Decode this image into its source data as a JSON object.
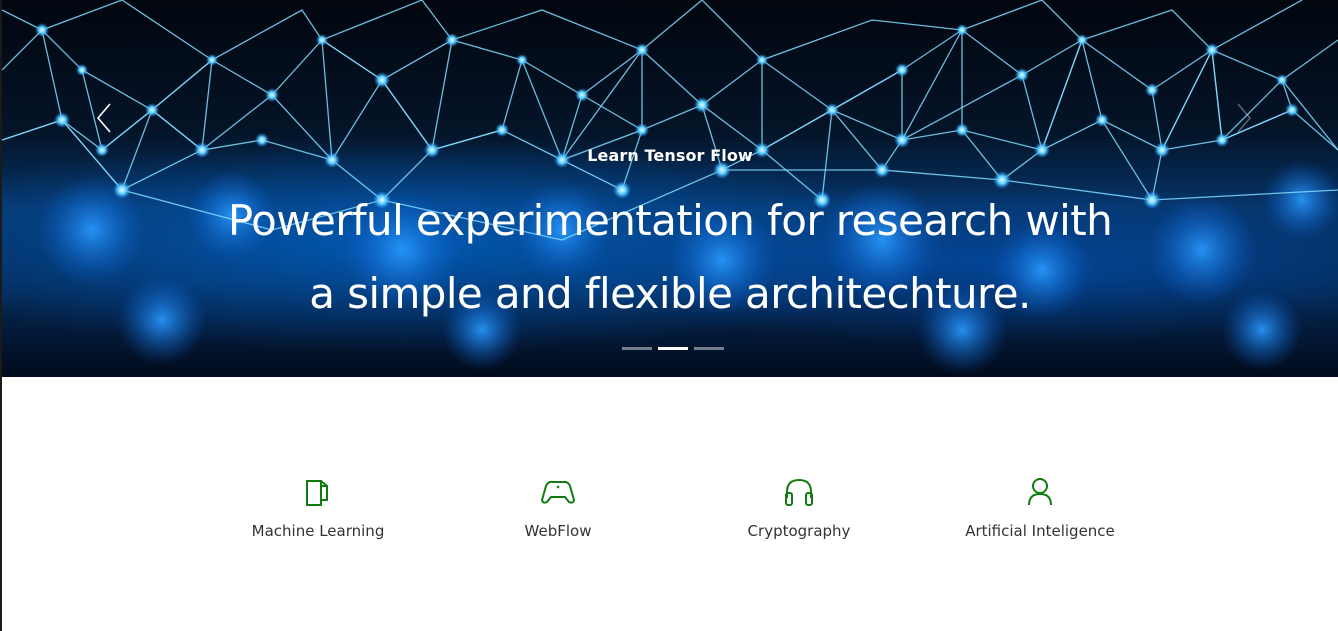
{
  "hero": {
    "eyebrow": "Learn Tensor Flow",
    "headline_line1": "Powerful experimentation for research with",
    "headline_line2": "a simple and flexible architechture.",
    "slide_count": 3,
    "active_slide": 2
  },
  "features": [
    {
      "label": "Machine Learning",
      "icon": "tablet-device-icon"
    },
    {
      "label": "WebFlow",
      "icon": "gamepad-icon"
    },
    {
      "label": "Cryptography",
      "icon": "headphones-icon"
    },
    {
      "label": "Artificial Inteligence",
      "icon": "person-icon"
    }
  ],
  "colors": {
    "accent": "#107c10",
    "text": "#333333",
    "hero_glow": "#1e90ff"
  }
}
